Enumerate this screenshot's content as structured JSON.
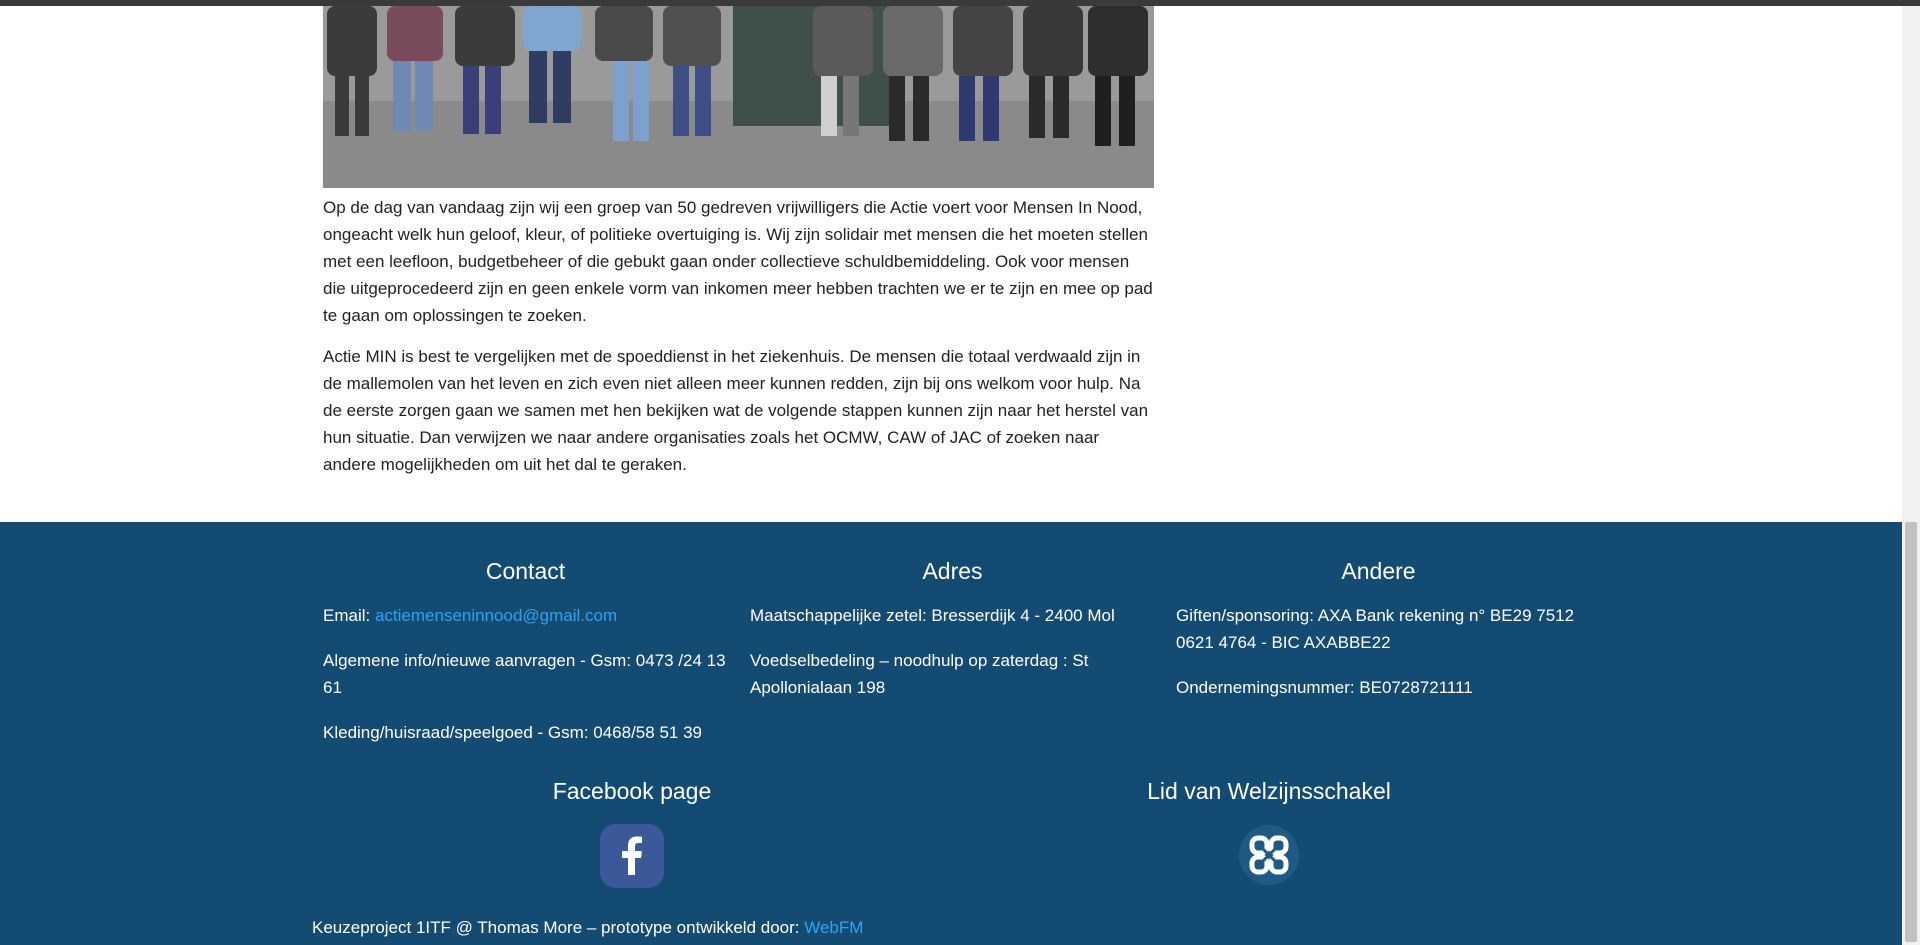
{
  "photo": {
    "alt": "Groepsfoto vrijwilligers Actie MIN"
  },
  "intro": {
    "paragraph1": "Op de dag van vandaag zijn wij een groep van 50 gedreven vrijwilligers die Actie voert voor Mensen In Nood, ongeacht welk hun geloof, kleur, of politieke overtuiging is. Wij zijn solidair met mensen die het moeten stellen met een leefloon, budgetbeheer of die gebukt gaan onder collectieve schuldbemiddeling. Ook voor mensen die uitgeprocedeerd zijn en geen enkele vorm van inkomen meer hebben trachten we er te zijn en mee op pad te gaan om oplossingen te zoeken.",
    "paragraph2": "Actie MIN is best te vergelijken met de spoeddienst in het ziekenhuis. De mensen die totaal verdwaald zijn in de mallemolen van het leven en zich even niet alleen meer kunnen redden, zijn bij ons welkom voor hulp. Na de eerste zorgen gaan we samen met hen bekijken wat de volgende stappen kunnen zijn naar het herstel van hun situatie. Dan verwijzen we naar andere organisaties zoals het OCMW, CAW of JAC of zoeken naar andere mogelijkheden om uit het dal te geraken."
  },
  "footer": {
    "contact": {
      "title": "Contact",
      "email_label": "Email: ",
      "email": "actiemenseninnood@gmail.com",
      "info": "Algemene info/nieuwe aanvragen - Gsm: 0473 /24 13 61",
      "kleding": "Kleding/huisraad/speelgoed - Gsm: 0468/58 51 39"
    },
    "adres": {
      "title": "Adres",
      "zetel": "Maatschappelijke zetel: Bresserdijk 4 - 2400 Mol",
      "voedsel": "Voedselbedeling – noodhulp op zaterdag : St Apollonialaan 198"
    },
    "andere": {
      "title": "Andere",
      "giften": "Giften/sponsoring: AXA Bank rekening n° BE29 7512 0621 4764 - BIC AXABBE22",
      "ondernemingsnummer": "Ondernemingsnummer: BE0728721111"
    },
    "facebook": {
      "title": "Facebook page",
      "icon": "facebook-icon"
    },
    "welzijn": {
      "title": "Lid van Welzijnsschakel",
      "icon": "welzijnsschakel-icon"
    },
    "credit": {
      "text": "Keuzeproject 1ITF @ Thomas More – prototype ontwikkeld door: ",
      "link": "WebFM"
    }
  },
  "colors": {
    "footer_bg": "#134b73",
    "link": "#2ea3f2",
    "facebook_bg": "#3b5998"
  }
}
